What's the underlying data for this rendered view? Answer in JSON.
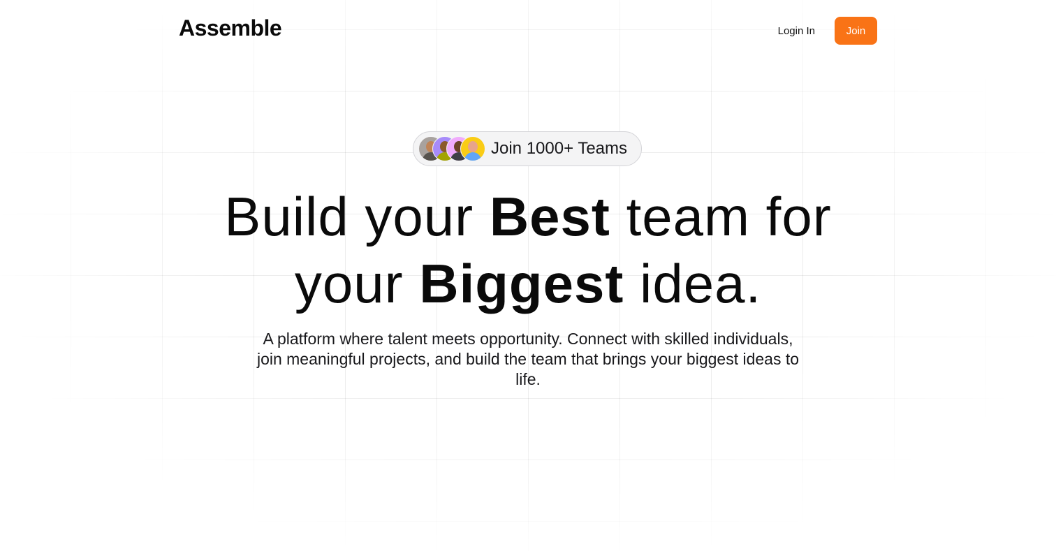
{
  "header": {
    "logo": "Assemble",
    "login_label": "Login In",
    "join_label": "Join"
  },
  "badge": {
    "text": "Join 1000+ Teams",
    "avatar_count": 4
  },
  "hero": {
    "line1_a": "Build your ",
    "line1_bold": "Best",
    "line1_b": " team for",
    "line2_a": "your ",
    "line2_bold": "Biggest",
    "line2_b": " idea.",
    "subtitle": "A platform where talent meets opportunity. Connect with skilled individuals, join meaningful projects, and build the team that brings your biggest ideas to life."
  },
  "colors": {
    "accent": "#f97316",
    "text": "#0a0a0a",
    "badge_bg": "#f4f4f5"
  }
}
